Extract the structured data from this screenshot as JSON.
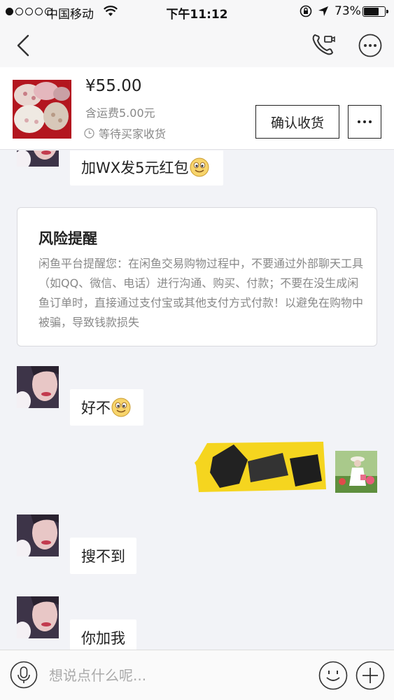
{
  "status_bar": {
    "carrier": "中国移动",
    "time": "下午11:12",
    "battery_percent": "73%",
    "battery_level": 0.73,
    "signal_bars_filled": 1,
    "signal_bars_total": 5
  },
  "nav": {
    "back_icon": "chevron-left-icon",
    "call_icon": "video-phone-icon",
    "more_icon": "ellipsis-circle-icon"
  },
  "order": {
    "price": "¥55.00",
    "shipping": "含运费5.00元",
    "status": "等待买家收货",
    "confirm_label": "确认收货",
    "more_icon": "ellipsis-icon"
  },
  "messages": [
    {
      "sender": "other",
      "text": "加WX发5元红包",
      "emoji": "smile-emoji"
    },
    {
      "type": "system",
      "title": "风险提醒",
      "body": "闲鱼平台提醒您：在闲鱼交易购物过程中，不要通过外部聊天工具（如QQ、微信、电话）进行沟通、购买、付款；不要在没生成闲鱼订单时，直接通过支付宝或其他支付方式付款！以避免在购物中被骗，导致钱款损失"
    },
    {
      "sender": "other",
      "text": "好不",
      "emoji": "smile-emoji"
    },
    {
      "sender": "me",
      "text": "",
      "redacted": true
    },
    {
      "sender": "other",
      "text": "搜不到"
    },
    {
      "sender": "other",
      "text": "你加我"
    }
  ],
  "input_bar": {
    "placeholder": "想说点什么呢...",
    "voice_icon": "microphone-icon",
    "emoji_icon": "smiley-icon",
    "plus_icon": "plus-circle-icon"
  },
  "colors": {
    "background": "#f2f3f7",
    "highlight_yellow": "#f5d51f",
    "text_primary": "#222222",
    "text_secondary": "#888888"
  }
}
